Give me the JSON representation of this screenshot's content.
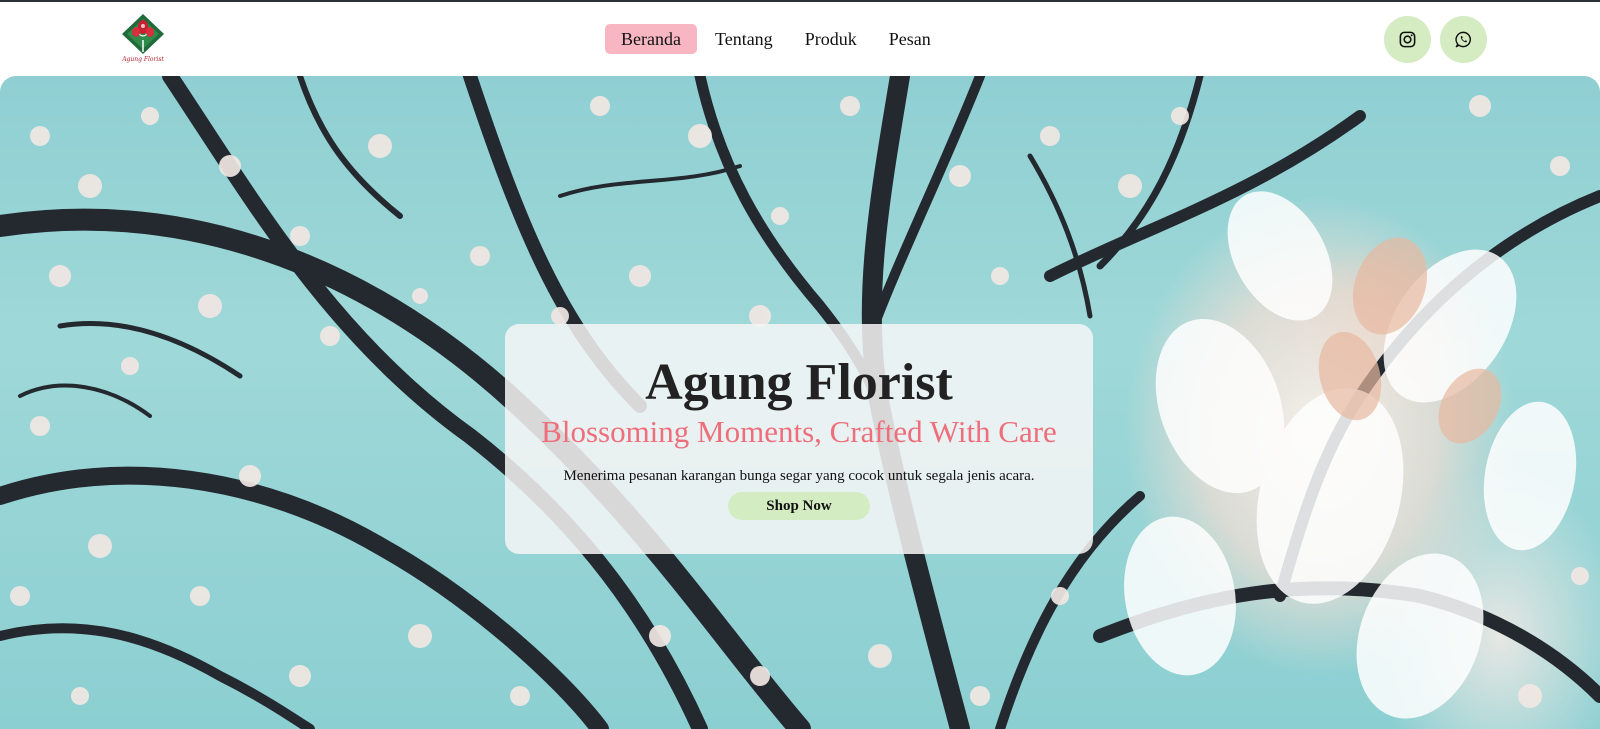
{
  "brand": {
    "logo_text": "Agung Florist"
  },
  "nav": {
    "items": [
      {
        "label": "Beranda",
        "active": true
      },
      {
        "label": "Tentang",
        "active": false
      },
      {
        "label": "Produk",
        "active": false
      },
      {
        "label": "Pesan",
        "active": false
      }
    ]
  },
  "social": [
    {
      "icon": "instagram-icon"
    },
    {
      "icon": "whatsapp-icon"
    }
  ],
  "hero": {
    "title": "Agung Florist",
    "tagline": "Blossoming Moments, Crafted With Care",
    "description": "Menerima pesanan karangan bunga segar yang cocok untuk segala jenis acara.",
    "cta_label": "Shop Now"
  },
  "colors": {
    "nav_active_bg": "#f7b6c2",
    "social_bg": "#d5ecc3",
    "tagline": "#ee6f7b",
    "cta_bg": "#d4ecc2",
    "sky": "#8fcfd3"
  }
}
